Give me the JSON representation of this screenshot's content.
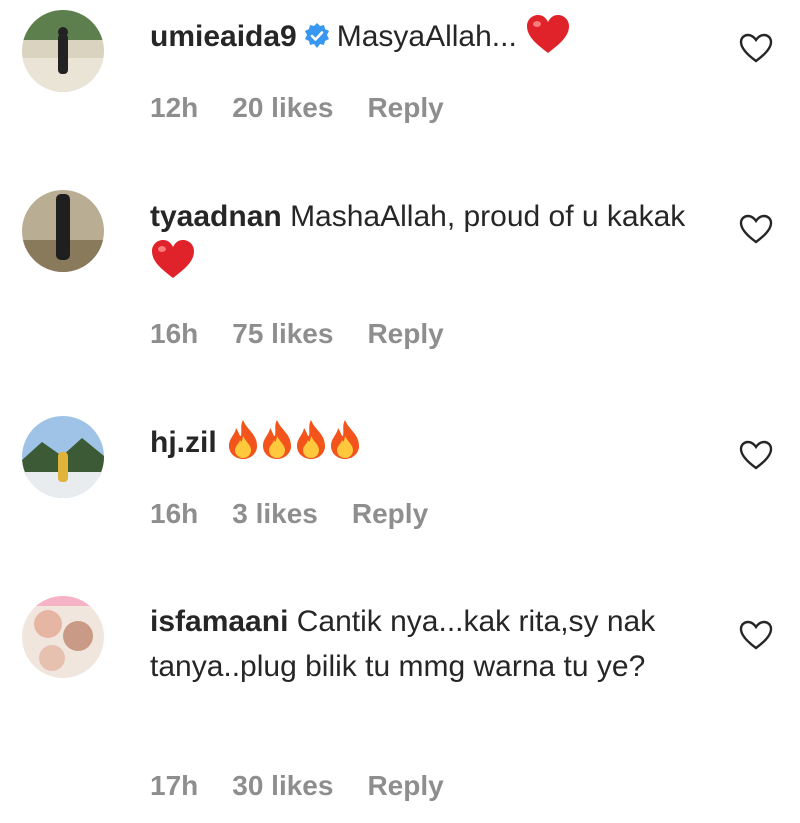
{
  "comments": [
    {
      "username": "umieaida9",
      "verified": true,
      "text": "MasyaAllah...",
      "emoji": [
        "red-heart"
      ],
      "time": "12h",
      "likes": "20 likes",
      "reply": "Reply"
    },
    {
      "username": "tyaadnan",
      "verified": false,
      "text": "MashaAllah, proud of u kakak",
      "emoji": [
        "red-heart"
      ],
      "time": "16h",
      "likes": "75 likes",
      "reply": "Reply"
    },
    {
      "username": "hj.zil",
      "verified": false,
      "text": "",
      "emoji": [
        "fire",
        "fire",
        "fire",
        "fire"
      ],
      "time": "16h",
      "likes": "3 likes",
      "reply": "Reply"
    },
    {
      "username": "isfamaani",
      "verified": false,
      "text": "Cantik nya...kak rita,sy nak tanya..plug bilik tu mmg warna tu ye?",
      "emoji": [],
      "time": "17h",
      "likes": "30 likes",
      "reply": "Reply"
    }
  ],
  "colors": {
    "text": "#262626",
    "meta": "#8e8e8e",
    "verified": "#3897f0",
    "heart_emoji": "#e0222a"
  },
  "icons": {
    "like": "heart-outline-icon",
    "verified": "verified-badge-icon"
  }
}
